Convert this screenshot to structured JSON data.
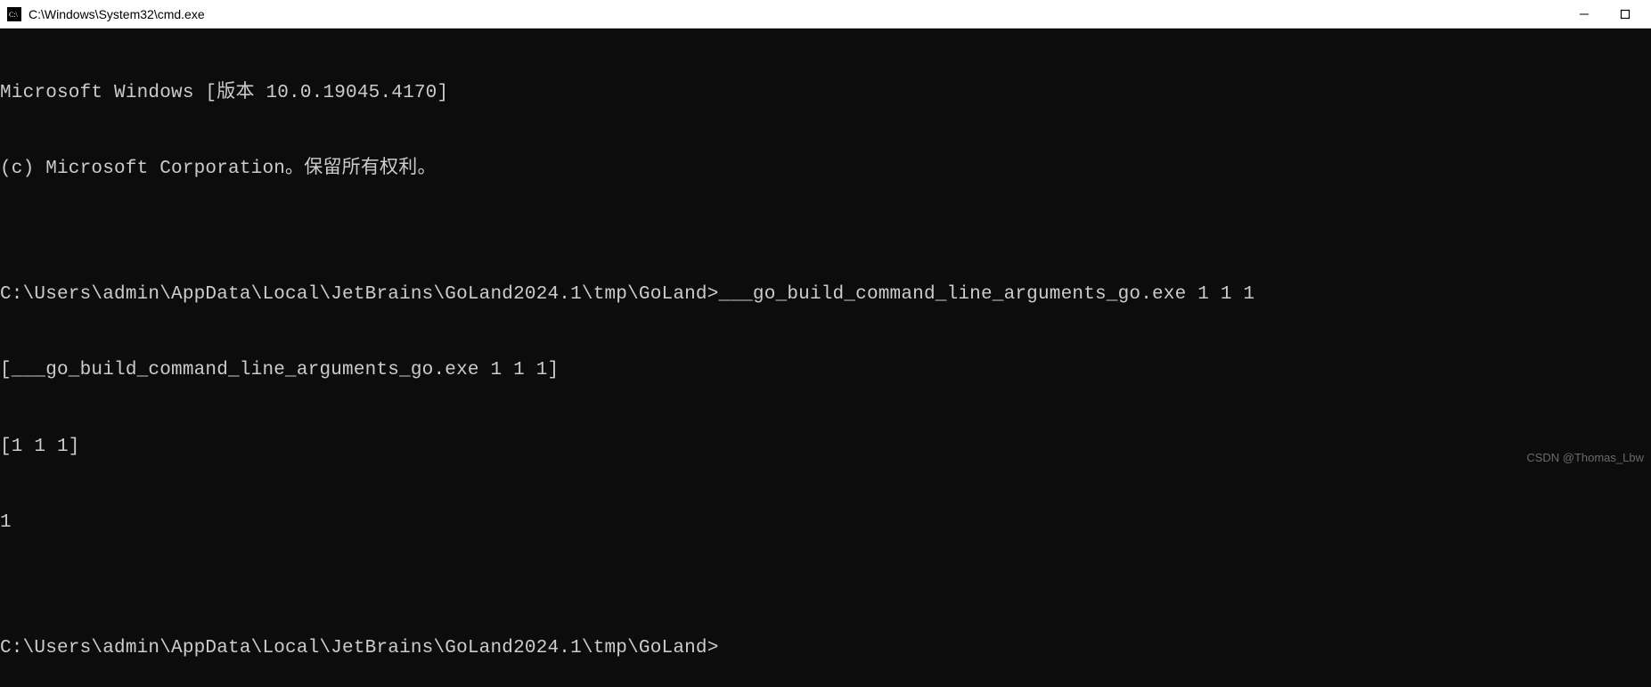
{
  "window": {
    "title": "C:\\Windows\\System32\\cmd.exe"
  },
  "terminal": {
    "lines": [
      "Microsoft Windows [版本 10.0.19045.4170]",
      "(c) Microsoft Corporation。保留所有权利。",
      "",
      "C:\\Users\\admin\\AppData\\Local\\JetBrains\\GoLand2024.1\\tmp\\GoLand>___go_build_command_line_arguments_go.exe 1 1 1",
      "[___go_build_command_line_arguments_go.exe 1 1 1]",
      "[1 1 1]",
      "1",
      "",
      "C:\\Users\\admin\\AppData\\Local\\JetBrains\\GoLand2024.1\\tmp\\GoLand>"
    ]
  },
  "watermark": "CSDN @Thomas_Lbw"
}
